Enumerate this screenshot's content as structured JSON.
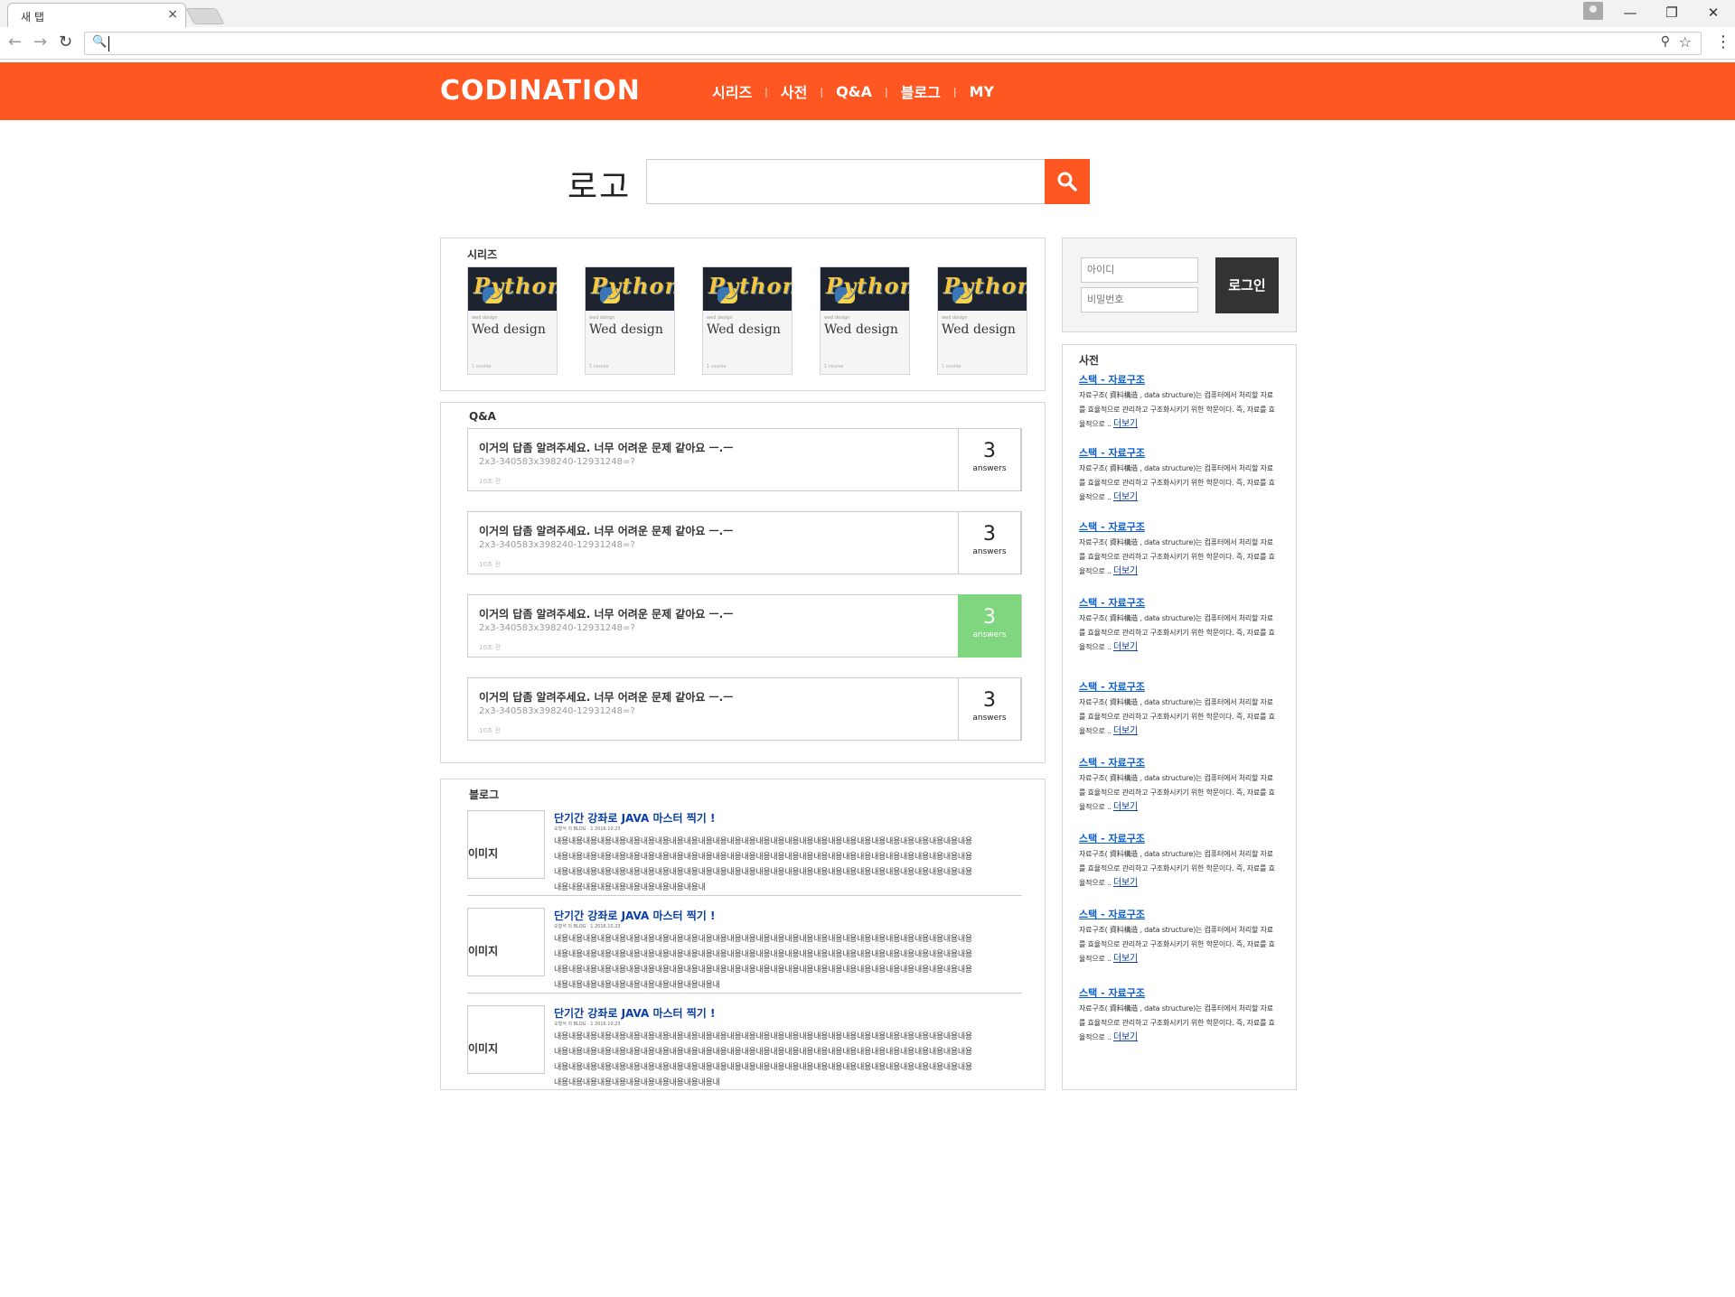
{
  "browser": {
    "tab_title": "새 탭",
    "tab_close": "×",
    "back": "←",
    "forward": "→",
    "reload": "↻",
    "search_glyph": "🔍",
    "zoom_glyph": "⚲",
    "star_glyph": "☆",
    "minimize": "—",
    "restore": "❐",
    "close": "✕",
    "menu": "⋮"
  },
  "site": {
    "brand": "CODINATION",
    "accent_color": "#ff5722",
    "nav": [
      "시리즈",
      "사전",
      "Q&A",
      "블로그",
      "MY"
    ],
    "separator": "|",
    "logo": "로고"
  },
  "series": {
    "title": "시리즈",
    "cards": [
      {
        "thumb": "Python",
        "small": "wed design",
        "name": "Wed design",
        "count": "1 course"
      },
      {
        "thumb": "Python",
        "small": "wed design",
        "name": "Wed design",
        "count": "1 course"
      },
      {
        "thumb": "Python",
        "small": "wed design",
        "name": "Wed design",
        "count": "1 course"
      },
      {
        "thumb": "Python",
        "small": "wed design",
        "name": "Wed design",
        "count": "1 course"
      },
      {
        "thumb": "Python",
        "small": "wed design",
        "name": "Wed design",
        "count": "1 course"
      }
    ]
  },
  "qa": {
    "title": "Q&A",
    "items": [
      {
        "question": "이거의 답좀 알려주세요. 너무 어려운 문제 같아요 ㅡ.ㅡ",
        "code": "2x3-340583x398240-12931248=?",
        "time": "10초 전",
        "count": "3",
        "label": "answers"
      },
      {
        "question": "이거의 답좀 알려주세요. 너무 어려운 문제 같아요 ㅡ.ㅡ",
        "code": "2x3-340583x398240-12931248=?",
        "time": "10초 전",
        "count": "3",
        "label": "answers"
      },
      {
        "question": "이거의 답좀 알려주세요. 너무 어려운 문제 같아요 ㅡ.ㅡ",
        "code": "2x3-340583x398240-12931248=?",
        "time": "10초 전",
        "count": "3",
        "label": "answers"
      },
      {
        "question": "이거의 답좀 알려주세요. 너무 어려운 문제 같아요 ㅡ.ㅡ",
        "code": "2x3-340583x398240-12931248=?",
        "time": "10초 전",
        "count": "3",
        "label": "answers"
      }
    ],
    "highlight_color": "#7fd67f"
  },
  "blog": {
    "title": "블로그",
    "items": [
      {
        "image": "이미지",
        "title": "단기간 강좌로 JAVA 마스터 찍기 !",
        "meta": "오형석 의 BLOG  ·  1   2016.10.23",
        "body": "내용내용내용내용내용내용내용내용내용내용내용내용내용내용내용내용내용내용내용내용내용내용내용내용내용내용내용내용내용내용내용내용내용내용내용내용내용내용내용내용내용내용내용내용내용내용내용내용내용내용내용내용내용내용내용내용내용내용내용내용내용내용내용내용내용내용내용내용내용내용내용내용내용내용내용내용내용내용내용내용내용내용내용내용내용내용내용내용내용내용내용내용내용내용내용내용내용내"
      },
      {
        "image": "이미지",
        "title": "단기간 강좌로 JAVA 마스터 찍기 !",
        "meta": "오형석 의 BLOG  ·  1   2016.10.23",
        "body": "내용내용내용내용내용내용내용내용내용내용내용내용내용내용내용내용내용내용내용내용내용내용내용내용내용내용내용내용내용내용내용내용내용내용내용내용내용내용내용내용내용내용내용내용내용내용내용내용내용내용내용내용내용내용내용내용내용내용내용내용내용내용내용내용내용내용내용내용내용내용내용내용내용내용내용내용내용내용내용내용내용내용내용내용내용내용내용내용내용내용내용내용내용내용내용내용내용내용내"
      },
      {
        "image": "이미지",
        "title": "단기간 강좌로 JAVA 마스터 찍기 !",
        "meta": "오형석 의 BLOG  ·  1   2016.10.23",
        "body": "내용내용내용내용내용내용내용내용내용내용내용내용내용내용내용내용내용내용내용내용내용내용내용내용내용내용내용내용내용내용내용내용내용내용내용내용내용내용내용내용내용내용내용내용내용내용내용내용내용내용내용내용내용내용내용내용내용내용내용내용내용내용내용내용내용내용내용내용내용내용내용내용내용내용내용내용내용내용내용내용내용내용내용내용내용내용내용내용내용내용내용내용내용내용내용내용내용내용내"
      }
    ]
  },
  "login": {
    "id_placeholder": "아이디",
    "pw_placeholder": "비밀번호",
    "button": "로그인"
  },
  "dictionary": {
    "title": "사전",
    "more": "더보기",
    "items": [
      {
        "head": "스택 - 자료구조",
        "body": "자료구조( 資料構造 , data structure)는 컴퓨터에서 처리할 자료를 효율적으로 관리하고 구조화시키기 위한 학문이다. 즉, 자료를 효율적으로 .. "
      },
      {
        "head": "스택 - 자료구조",
        "body": "자료구조( 資料構造 , data structure)는 컴퓨터에서 처리할 자료를 효율적으로 관리하고 구조화시키기 위한 학문이다. 즉, 자료를 효율적으로 .. "
      },
      {
        "head": "스택 - 자료구조",
        "body": "자료구조( 資料構造 , data structure)는 컴퓨터에서 처리할 자료를 효율적으로 관리하고 구조화시키기 위한 학문이다. 즉, 자료를 효율적으로 .. "
      },
      {
        "head": "스택 - 자료구조",
        "body": "자료구조( 資料構造 , data structure)는 컴퓨터에서 처리할 자료를 효율적으로 관리하고 구조화시키기 위한 학문이다. 즉, 자료를 효율적으로 .. "
      },
      {
        "head": "스택 - 자료구조",
        "body": "자료구조( 資料構造 , data structure)는 컴퓨터에서 처리할 자료를 효율적으로 관리하고 구조화시키기 위한 학문이다. 즉, 자료를 효율적으로 .. "
      },
      {
        "head": "스택 - 자료구조",
        "body": "자료구조( 資料構造 , data structure)는 컴퓨터에서 처리할 자료를 효율적으로 관리하고 구조화시키기 위한 학문이다. 즉, 자료를 효율적으로 .. "
      },
      {
        "head": "스택 - 자료구조",
        "body": "자료구조( 資料構造 , data structure)는 컴퓨터에서 처리할 자료를 효율적으로 관리하고 구조화시키기 위한 학문이다. 즉, 자료를 효율적으로 .. "
      },
      {
        "head": "스택 - 자료구조",
        "body": "자료구조( 資料構造 , data structure)는 컴퓨터에서 처리할 자료를 효율적으로 관리하고 구조화시키기 위한 학문이다. 즉, 자료를 효율적으로 .. "
      },
      {
        "head": "스택 - 자료구조",
        "body": "자료구조( 資料構造 , data structure)는 컴퓨터에서 처리할 자료를 효율적으로 관리하고 구조화시키기 위한 학문이다. 즉, 자료를 효율적으로 .. "
      }
    ]
  }
}
